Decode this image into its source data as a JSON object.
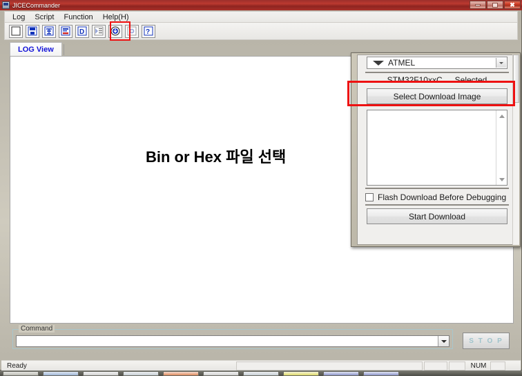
{
  "window": {
    "title": "JICECommander",
    "icon": "app-icon",
    "controls": {
      "minimize": "minimize",
      "maximize": "maximize",
      "close": "close"
    }
  },
  "menu": {
    "items": [
      {
        "label": "Log"
      },
      {
        "label": "Script"
      },
      {
        "label": "Function"
      },
      {
        "label": "Help(H)"
      }
    ]
  },
  "toolbar": {
    "buttons": [
      {
        "icon": "new-document-icon",
        "highlighted": false
      },
      {
        "icon": "save-disk-icon",
        "highlighted": false
      },
      {
        "icon": "script-run-icon",
        "highlighted": false
      },
      {
        "icon": "file-list-icon",
        "highlighted": false
      },
      {
        "icon": "debug-d-icon",
        "highlighted": false
      },
      {
        "icon": "window-list-icon",
        "highlighted": false
      },
      {
        "icon": "download-target-icon",
        "highlighted": true
      },
      {
        "icon": "connect-plus-icon",
        "highlighted": false
      },
      {
        "icon": "help-question-icon",
        "highlighted": false
      }
    ],
    "highlight_color": "#ee1111"
  },
  "tabs": {
    "items": [
      {
        "label": "LOG View",
        "active": true
      }
    ],
    "active_color": "#1212d8"
  },
  "logview": {
    "annotation": "Bin or Hex 파일 선택",
    "content": ""
  },
  "download_panel": {
    "vendor_combo": {
      "value": "ATMEL",
      "logo": "atmel-logo-icon"
    },
    "selected_device": "STM32F10xxC",
    "selected_state": "Selected",
    "select_image_button": "Select Download Image",
    "image_list": [],
    "flash_checkbox": {
      "label": "Flash Download Before Debugging",
      "checked": false
    },
    "start_button": "Start Download",
    "highlight_color": "#ee1111"
  },
  "command": {
    "legend": "Command",
    "value": "",
    "placeholder": ""
  },
  "stop_button": {
    "label": "S T O P",
    "enabled": false,
    "text_color": "#9fc4cc"
  },
  "statusbar": {
    "message": "Ready",
    "num_indicator": "NUM"
  },
  "taskbar": {
    "items": [
      {
        "name": "taskbar-item-1"
      },
      {
        "name": "taskbar-item-2"
      },
      {
        "name": "taskbar-item-3"
      },
      {
        "name": "taskbar-item-4"
      },
      {
        "name": "taskbar-item-5"
      },
      {
        "name": "taskbar-item-6"
      },
      {
        "name": "taskbar-item-7"
      },
      {
        "name": "taskbar-item-8"
      },
      {
        "name": "taskbar-item-9"
      }
    ]
  }
}
